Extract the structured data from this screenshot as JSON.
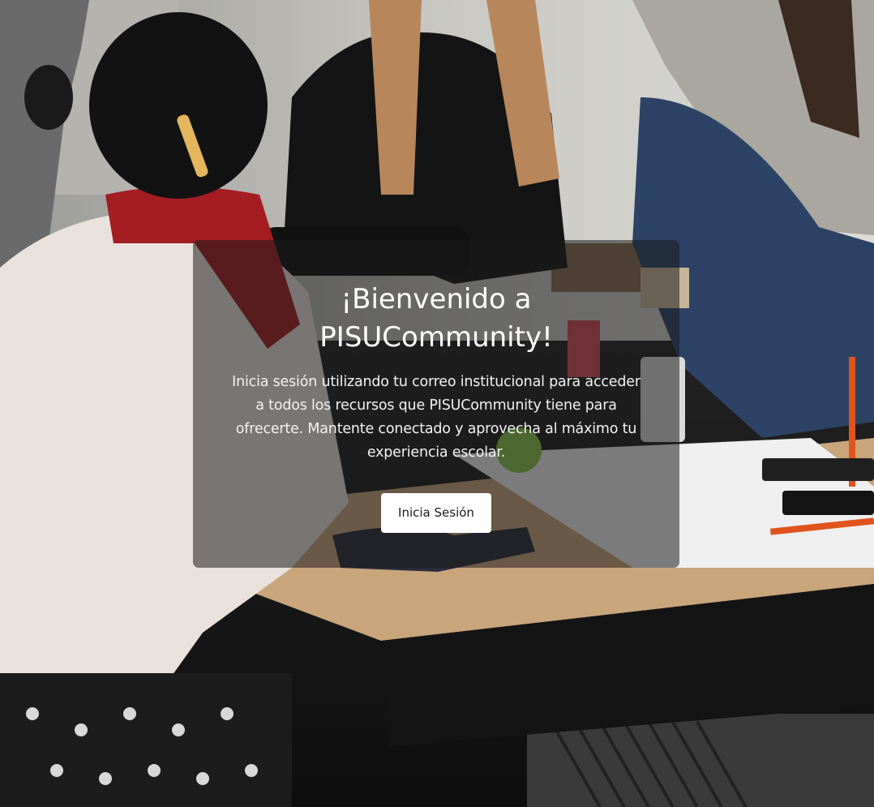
{
  "welcome": {
    "title_line1": "¡Bienvenido a",
    "title_line2": "PISUCommunity!",
    "description": "Inicia sesión utilizando tu correo institucional para acceder a todos los recursos que PISUCommunity tiene para ofrecerte. Mantente conectado y aprovecha al máximo tu experiencia escolar.",
    "login_button_label": "Inicia Sesión"
  },
  "colors": {
    "card_overlay": "#1c1c1c",
    "button_bg": "#ffffff",
    "button_text": "#1a1a1a",
    "text": "#ffffff"
  }
}
